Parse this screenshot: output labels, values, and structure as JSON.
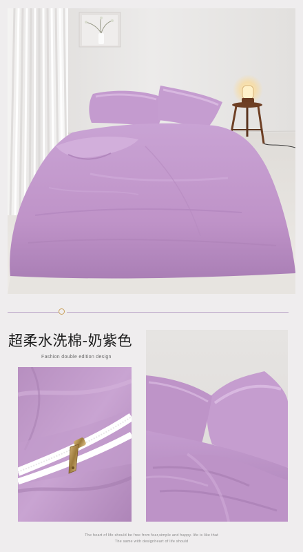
{
  "product": {
    "title": "超柔水洗棉-奶紫色",
    "subtitle": "Fashion double edition design"
  },
  "footer": {
    "line1": "The heart of life should be free from fear,simple and happy. life is like that",
    "line2": "The same with designheart of life should"
  },
  "colors": {
    "accent_purple": "#b98fc2",
    "divider_line": "#b9a3c6",
    "divider_dot": "#c9a15c",
    "background": "#efedee"
  }
}
